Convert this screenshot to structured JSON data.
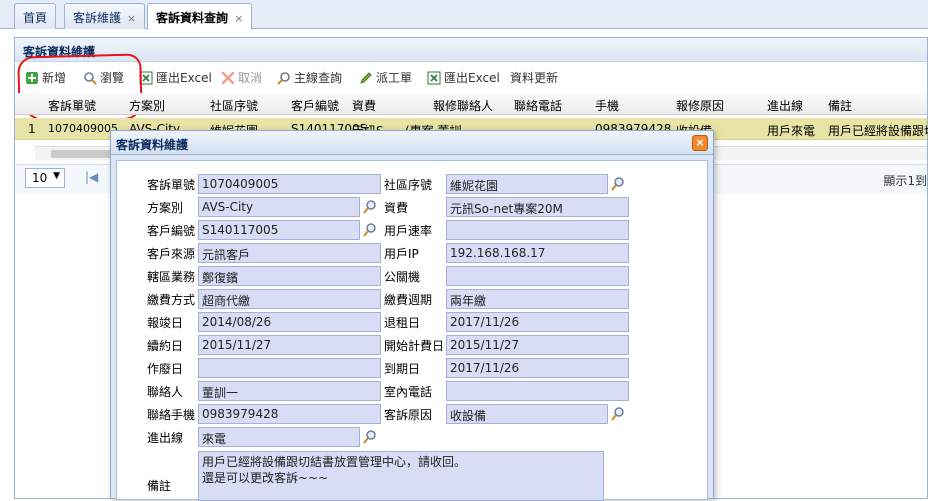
{
  "tabs": [
    {
      "label": "首頁",
      "closable": false
    },
    {
      "label": "客訴維護",
      "closable": true
    },
    {
      "label": "客訴資料查詢",
      "closable": true,
      "active": true
    }
  ],
  "tab_close_glyph": "×",
  "panel": {
    "title": "客訴資料維護"
  },
  "toolbar": {
    "add": "新增",
    "browse": "瀏覽",
    "export1": "匯出Excel",
    "cancel": "取消",
    "query": "主線查詢",
    "dispatch": "派工單",
    "export2": "匯出Excel",
    "update": "資料更新"
  },
  "grid": {
    "columns": [
      "客訴單號",
      "方案別",
      "社區序號",
      "客戶編號",
      "資費",
      "報修聯絡人",
      "聯絡電話",
      "手機",
      "報修原因",
      "進出線",
      "備註"
    ],
    "row": {
      "index": "1",
      "cells": [
        "1070409005",
        "AVS-City",
        "維妮花園",
        "S140117005",
        "元訊S",
        "(專案 董訓",
        "",
        "0983979428",
        "收設備",
        "用戶來電",
        "用戶已經將設備跟切"
      ]
    }
  },
  "pager": {
    "page_size": "10",
    "first_glyph": "|◀",
    "info": "顯示1到"
  },
  "dialog": {
    "title": "客訴資料維護",
    "close_glyph": "×",
    "fields": {
      "complaint_no": {
        "label": "客訴單號",
        "value": "1070409005"
      },
      "community_no": {
        "label": "社區序號",
        "value": "維妮花園"
      },
      "plan": {
        "label": "方案別",
        "value": "AVS-City"
      },
      "fee": {
        "label": "資費",
        "value": "元訊So-net專案20M"
      },
      "customer_no": {
        "label": "客戶編號",
        "value": "S140117005"
      },
      "user_speed": {
        "label": "用戶速率",
        "value": ""
      },
      "customer_source": {
        "label": "客戶來源",
        "value": "元訊客戶"
      },
      "user_ip": {
        "label": "用戶IP",
        "value": "192.168.168.17"
      },
      "area_sales": {
        "label": "轄區業務",
        "value": "鄭復鑌"
      },
      "public_machine": {
        "label": "公關機",
        "value": ""
      },
      "payment_method": {
        "label": "繳費方式",
        "value": "超商代繳"
      },
      "payment_cycle": {
        "label": "繳費週期",
        "value": "兩年繳"
      },
      "install_date": {
        "label": "報竣日",
        "value": "2014/08/26"
      },
      "return_date": {
        "label": "退租日",
        "value": "2017/11/26"
      },
      "renewal_date": {
        "label": "續約日",
        "value": "2015/11/27"
      },
      "billing_start": {
        "label": "開始計費日",
        "value": "2015/11/27"
      },
      "void_date": {
        "label": "作廢日",
        "value": ""
      },
      "expire_date": {
        "label": "到期日",
        "value": "2017/11/26"
      },
      "contact": {
        "label": "聯絡人",
        "value": "董訓一"
      },
      "home_phone": {
        "label": "室內電話",
        "value": ""
      },
      "contact_mobile": {
        "label": "聯絡手機",
        "value": "0983979428"
      },
      "complaint_reason": {
        "label": "客訴原因",
        "value": "收設備"
      },
      "line_in_out": {
        "label": "進出線",
        "value": "來電"
      },
      "remarks": {
        "label": "備註",
        "value": "用戶已經將設備跟切結書放置管理中心，請收回。\n還是可以更改客訴~~~"
      }
    }
  },
  "colors": {
    "annotation": "#e4141b",
    "selected_row": "#e8e4a8",
    "field_bg": "#d8dcf5"
  }
}
